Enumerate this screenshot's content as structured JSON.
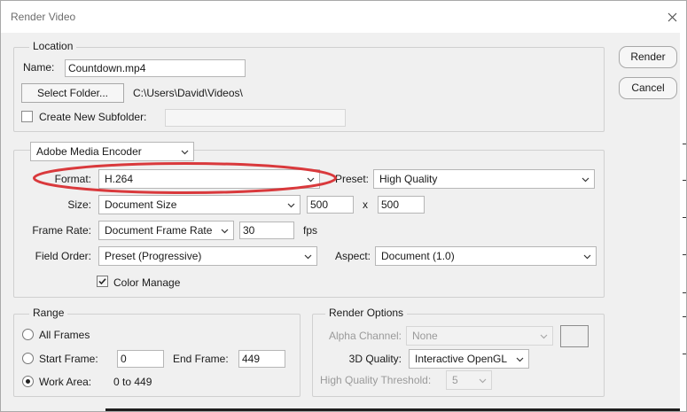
{
  "window": {
    "title": "Render Video",
    "close_symbol": "✕"
  },
  "buttons": {
    "render": "Render",
    "cancel": "Cancel"
  },
  "location": {
    "legend": "Location",
    "name_label": "Name:",
    "name_value": "Countdown.mp4",
    "select_folder": "Select Folder...",
    "folder_path": "C:\\Users\\David\\Videos\\",
    "create_subfolder_label": "Create New Subfolder:",
    "create_subfolder_checked": false,
    "subfolder_value": ""
  },
  "encoder": {
    "renderer": "Adobe Media Encoder",
    "format_label": "Format:",
    "format_value": "H.264",
    "preset_label": "Preset:",
    "preset_value": "High Quality",
    "size_label": "Size:",
    "size_value": "Document Size",
    "width": "500",
    "by": "x",
    "height": "500",
    "frame_rate_label": "Frame Rate:",
    "frame_rate_value": "Document Frame Rate",
    "fps_value": "30",
    "fps_unit": "fps",
    "field_order_label": "Field Order:",
    "field_order_value": "Preset (Progressive)",
    "aspect_label": "Aspect:",
    "aspect_value": "Document (1.0)",
    "color_manage_label": "Color Manage",
    "color_manage_checked": true
  },
  "range": {
    "legend": "Range",
    "all_frames": "All Frames",
    "start_frame_label": "Start Frame:",
    "start_frame_value": "0",
    "end_frame_label": "End Frame:",
    "end_frame_value": "449",
    "work_area_label": "Work Area:",
    "work_area_value": "0 to 449",
    "selected": "work_area"
  },
  "render_options": {
    "legend": "Render Options",
    "alpha_label": "Alpha Channel:",
    "alpha_value": "None",
    "quality_label": "3D Quality:",
    "quality_value": "Interactive OpenGL",
    "threshold_label": "High Quality Threshold:",
    "threshold_value": "5"
  },
  "colors": {
    "annotation": "#d9393c",
    "background": "#f0f0f0"
  }
}
